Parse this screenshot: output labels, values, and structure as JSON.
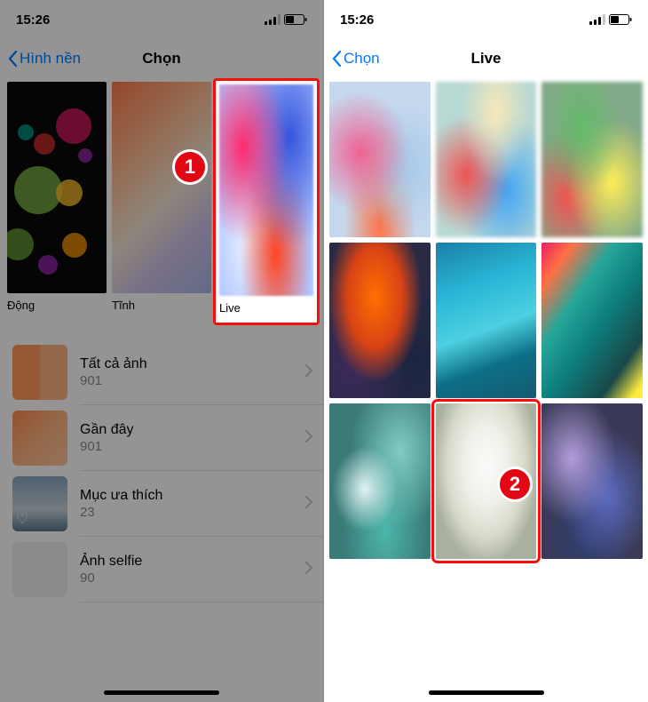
{
  "status": {
    "time": "15:26"
  },
  "left": {
    "nav": {
      "back": "Hình nền",
      "title": "Chọn"
    },
    "categories": [
      {
        "label": "Động"
      },
      {
        "label": "Tĩnh"
      },
      {
        "label": "Live"
      }
    ],
    "albums": [
      {
        "title": "Tất cả ảnh",
        "count": "901"
      },
      {
        "title": "Gần đây",
        "count": "901"
      },
      {
        "title": "Mục ưa thích",
        "count": "23"
      },
      {
        "title": "Ảnh selfie",
        "count": "90"
      }
    ],
    "badge": "1"
  },
  "right": {
    "nav": {
      "back": "Chọn",
      "title": "Live"
    },
    "badge": "2"
  }
}
